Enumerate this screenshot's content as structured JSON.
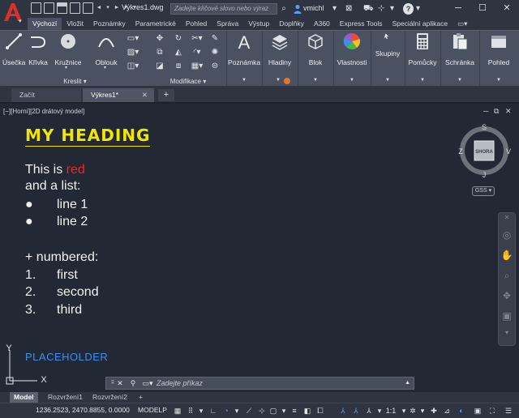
{
  "titlebar": {
    "app_logo_letter": "A",
    "document_title": "Výkres1.dwg",
    "search_placeholder": "Zadejte klíčové slovo nebo výraz",
    "user_name": "vmichl",
    "help_label": "?",
    "colors": {
      "bg": "#2e3440",
      "logo": "#d9302a"
    }
  },
  "ribbon_tabs": [
    {
      "label": "Výchozí",
      "active": true
    },
    {
      "label": "Vložit"
    },
    {
      "label": "Poznámky"
    },
    {
      "label": "Parametrické"
    },
    {
      "label": "Pohled"
    },
    {
      "label": "Správa"
    },
    {
      "label": "Výstup"
    },
    {
      "label": "Doplňky"
    },
    {
      "label": "A360"
    },
    {
      "label": "Express Tools"
    },
    {
      "label": "Speciální aplikace"
    }
  ],
  "ribbon": {
    "draw": {
      "title": "Kreslit",
      "tools": [
        {
          "label": "Úsečka",
          "icon": "line-icon"
        },
        {
          "label": "Křivka",
          "icon": "polyline-icon"
        },
        {
          "label": "Kružnice",
          "icon": "circle-icon"
        },
        {
          "label": "Oblouk",
          "icon": "arc-icon"
        }
      ]
    },
    "modify": {
      "title": "Modifikace"
    },
    "panels": [
      {
        "label": "Poznámka",
        "icon": "text-annotation-icon"
      },
      {
        "label": "Hladiny",
        "icon": "layers-icon"
      },
      {
        "label": "Blok",
        "icon": "block-icon"
      },
      {
        "label": "Vlastnosti",
        "icon": "color-wheel-icon"
      },
      {
        "label": "Skupiny",
        "icon": "groups-icon"
      },
      {
        "label": "Pomůcky",
        "icon": "calculator-icon"
      },
      {
        "label": "Schránka",
        "icon": "clipboard-icon"
      },
      {
        "label": "Pohled",
        "icon": "view-icon"
      }
    ]
  },
  "file_tabs": {
    "start": "Začít",
    "active": "Výkres1*",
    "add": "+"
  },
  "viewport": {
    "label": "[−][Horní][2D drátový model]"
  },
  "drawing": {
    "heading": "MY HEADING",
    "line1_prefix": "This is ",
    "line1_red": "red",
    "line2": "and a list:",
    "bullets": [
      "line 1",
      "line 2"
    ],
    "numbered_intro": "+ numbered:",
    "numbered": [
      {
        "num": "1.",
        "text": "first"
      },
      {
        "num": "2.",
        "text": "second"
      },
      {
        "num": "3.",
        "text": "third"
      }
    ],
    "placeholder": "PLACEHOLDER",
    "colors": {
      "heading": "#f2e600",
      "red": "#ff2020",
      "placeholder": "#3d8ff0",
      "text": "#f2f2f2"
    }
  },
  "viewcube": {
    "north": "S",
    "south": "J",
    "east": "V",
    "west": "Z",
    "face": "SHORA",
    "wcs": "GSS"
  },
  "ucs": {
    "x": "X",
    "y": "Y"
  },
  "command_line": {
    "prompt": "Zadejte příkaz"
  },
  "layout_tabs": [
    "Model",
    "Rozvržení1",
    "Rozvržení2"
  ],
  "status_bar": {
    "coordinates": "1236.2523, 2470.8855, 0.0000",
    "space": "MODELP",
    "scale": "1:1"
  }
}
